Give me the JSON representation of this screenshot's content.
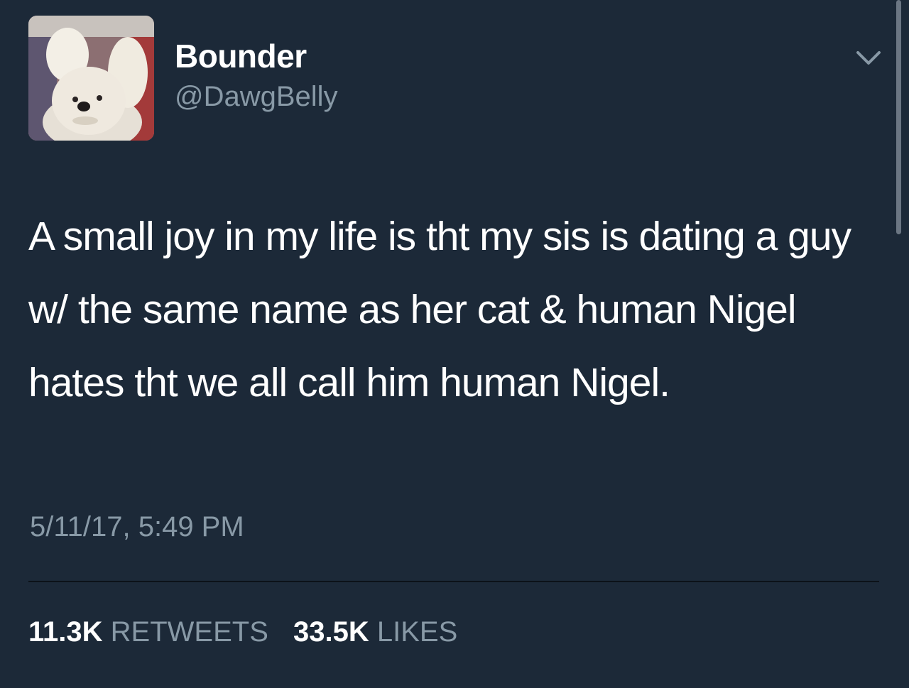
{
  "user": {
    "display_name": "Bounder",
    "handle": "@DawgBelly"
  },
  "icons": {
    "menu": "chevron-down-icon",
    "avatar": "dog-in-bunny-ears-photo"
  },
  "tweet": {
    "text": "A small joy in my life is tht my sis is dating a guy w/ the same name as her cat & human Nigel hates tht we all call him human Nigel.",
    "timestamp": "5/11/17, 5:49 PM"
  },
  "stats": {
    "retweets_count": "11.3K",
    "retweets_label": "RETWEETS",
    "likes_count": "33.5K",
    "likes_label": "LIKES"
  },
  "colors": {
    "background": "#1c2938",
    "secondary_text": "#8899a6",
    "primary_text": "#ffffff"
  }
}
